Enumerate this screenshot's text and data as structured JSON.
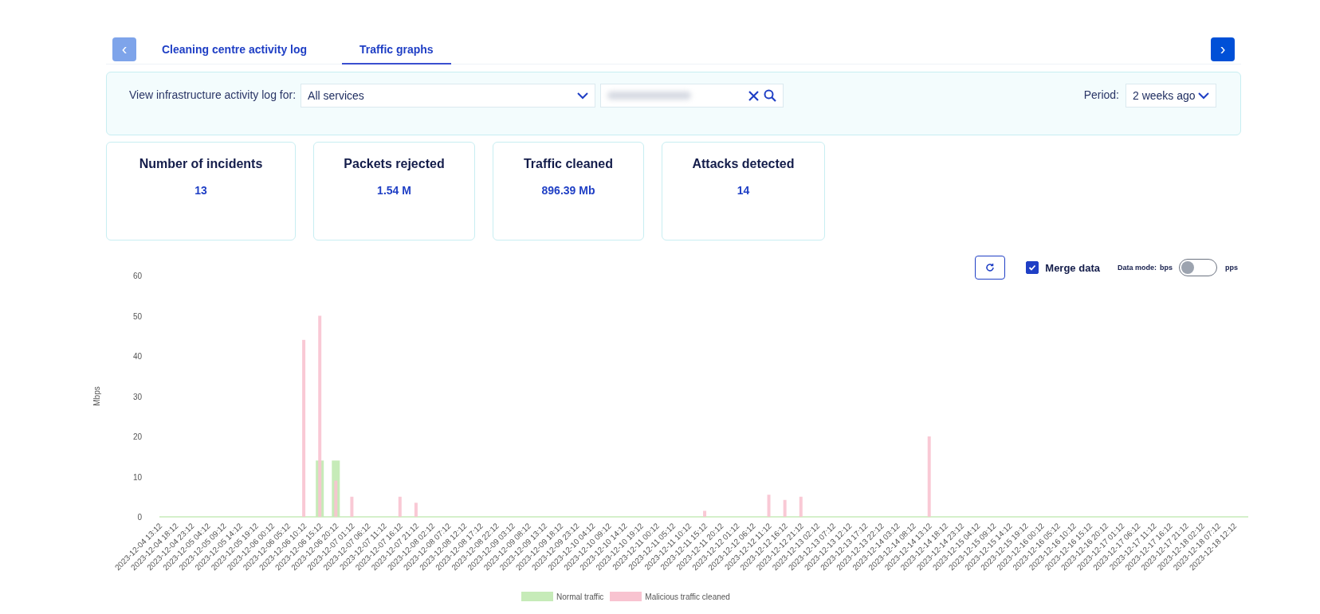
{
  "nav": {
    "back": {
      "label": "‹",
      "disabled": true
    },
    "next": {
      "label": "›",
      "disabled": false
    }
  },
  "tabs": [
    {
      "label": "Cleaning centre activity log",
      "selected": false
    },
    {
      "label": "Traffic graphs",
      "selected": true
    }
  ],
  "filter": {
    "label": "View infrastructure activity log for:",
    "service": "All services",
    "address": {
      "redacted": true
    },
    "period_label": "Period:",
    "period": "2 weeks ago"
  },
  "stats": [
    {
      "title": "Number of incidents",
      "value": "13"
    },
    {
      "title": "Packets rejected",
      "value": "1.54 M"
    },
    {
      "title": "Traffic cleaned",
      "value": "896.39 Mb"
    },
    {
      "title": "Attacks detected",
      "value": "14"
    }
  ],
  "controls": {
    "merge_data": {
      "label": "Merge data",
      "checked": true
    },
    "data_mode": {
      "label": "Data mode:",
      "off_label": "bps",
      "on_label": "pps",
      "on": false
    }
  },
  "chart_data": {
    "type": "bar",
    "ylabel": "Mbps",
    "ylim": [
      0,
      60
    ],
    "yticks": [
      0,
      10,
      20,
      30,
      40,
      50,
      60
    ],
    "categories": [
      "2023-12-04 13:12",
      "2023-12-04 18:12",
      "2023-12-04 23:12",
      "2023-12-05 04:12",
      "2023-12-05 09:12",
      "2023-12-05 14:12",
      "2023-12-05 19:12",
      "2023-12-06 00:12",
      "2023-12-06 05:12",
      "2023-12-06 10:12",
      "2023-12-06 15:12",
      "2023-12-06 20:12",
      "2023-12-07 01:12",
      "2023-12-07 06:12",
      "2023-12-07 11:12",
      "2023-12-07 16:12",
      "2023-12-07 21:12",
      "2023-12-08 02:12",
      "2023-12-08 07:12",
      "2023-12-08 12:12",
      "2023-12-08 17:12",
      "2023-12-08 22:12",
      "2023-12-09 03:12",
      "2023-12-09 08:12",
      "2023-12-09 13:12",
      "2023-12-09 18:12",
      "2023-12-09 23:12",
      "2023-12-10 04:12",
      "2023-12-10 09:12",
      "2023-12-10 14:12",
      "2023-12-10 19:12",
      "2023-12-11 00:12",
      "2023-12-11 05:12",
      "2023-12-11 10:12",
      "2023-12-11 15:12",
      "2023-12-11 20:12",
      "2023-12-12 01:12",
      "2023-12-12 06:12",
      "2023-12-12 11:12",
      "2023-12-12 16:12",
      "2023-12-12 21:12",
      "2023-12-13 02:12",
      "2023-12-13 07:12",
      "2023-12-13 12:12",
      "2023-12-13 17:12",
      "2023-12-13 22:12",
      "2023-12-14 03:12",
      "2023-12-14 08:12",
      "2023-12-14 13:12",
      "2023-12-14 18:12",
      "2023-12-14 23:12",
      "2023-12-15 04:12",
      "2023-12-15 09:12",
      "2023-12-15 14:12",
      "2023-12-15 19:12",
      "2023-12-16 00:12",
      "2023-12-16 05:12",
      "2023-12-16 10:12",
      "2023-12-16 15:12",
      "2023-12-16 20:12",
      "2023-12-17 01:12",
      "2023-12-17 06:12",
      "2023-12-17 11:12",
      "2023-12-17 16:12",
      "2023-12-17 21:12",
      "2023-12-18 02:12",
      "2023-12-18 07:12",
      "2023-12-18 12:12"
    ],
    "series": [
      {
        "name": "Normal traffic",
        "color": "#c6ebb8",
        "values": [
          0,
          0,
          0,
          0,
          0,
          0,
          0,
          0,
          0,
          0,
          14,
          14,
          0,
          0,
          0,
          0,
          0,
          0,
          0,
          0,
          0,
          0,
          0,
          0,
          0,
          0,
          0,
          0,
          0,
          0,
          0,
          0,
          0,
          0,
          0,
          0,
          0,
          0,
          0,
          0,
          0,
          0,
          0,
          0,
          0,
          0,
          0,
          0,
          0,
          0,
          0,
          0,
          0,
          0,
          0,
          0,
          0,
          0,
          0,
          0,
          0,
          0,
          0,
          0,
          0,
          0,
          0,
          0
        ]
      },
      {
        "name": "Malicious traffic cleaned",
        "color": "#f8c3d0",
        "values": [
          0,
          0,
          0,
          0,
          0,
          0,
          0,
          0,
          0,
          44,
          50,
          9,
          5,
          0,
          0,
          5,
          3.5,
          0,
          0,
          0,
          0,
          0,
          0,
          0,
          0,
          0,
          0,
          0,
          0,
          0,
          0,
          0,
          0,
          0,
          1.5,
          0,
          0,
          0,
          5.5,
          4.2,
          5,
          0,
          0,
          0,
          0,
          0,
          0,
          0,
          20,
          0,
          0,
          0,
          0,
          0,
          0,
          0,
          0,
          0,
          0,
          0,
          0,
          0,
          0,
          0,
          0,
          0,
          0,
          0
        ]
      }
    ]
  }
}
